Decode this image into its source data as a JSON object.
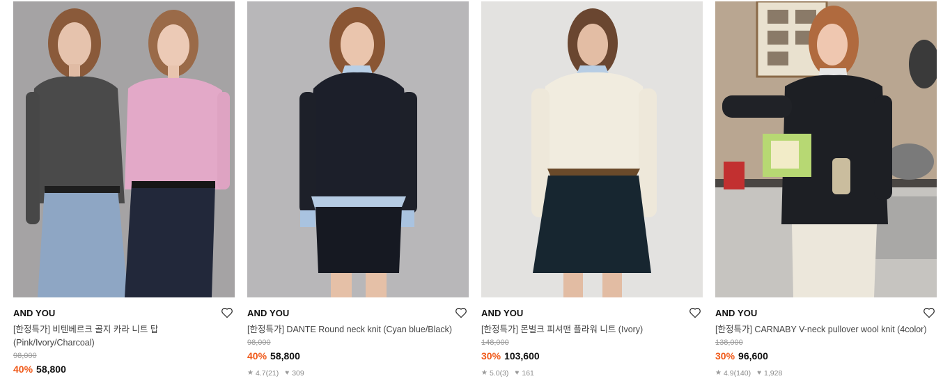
{
  "products": [
    {
      "brand": "AND YOU",
      "name": "[한정특가] 비텐베르크 골지 카라 니트 탑 (Pink/Ivory/Charcoal)",
      "original_price": "98,000",
      "discount": "40%",
      "price": "58,800",
      "rating": "",
      "reviews": "",
      "likes": ""
    },
    {
      "brand": "AND YOU",
      "name": "[한정특가] DANTE Round neck knit (Cyan blue/Black)",
      "original_price": "98,000",
      "discount": "40%",
      "price": "58,800",
      "rating": "4.7",
      "reviews": "(21)",
      "likes": "309"
    },
    {
      "brand": "AND YOU",
      "name": "[한정특가] 몬벌크 피셔맨 플라워 니트 (Ivory)",
      "original_price": "148,000",
      "discount": "30%",
      "price": "103,600",
      "rating": "5.0",
      "reviews": "(3)",
      "likes": "161"
    },
    {
      "brand": "AND YOU",
      "name": "[한정특가] CARNABY V-neck pullover wool knit (4color)",
      "original_price": "138,000",
      "discount": "30%",
      "price": "96,600",
      "rating": "4.9",
      "reviews": "(140)",
      "likes": "1,928"
    }
  ],
  "icons": {
    "wishlist": "heart-outline-icon",
    "rating": "star-icon",
    "likes": "heart-filled-icon"
  },
  "colors": {
    "discount": "#f05a1a",
    "original_price": "#9a9a9a",
    "meta": "#8a8a8a"
  }
}
